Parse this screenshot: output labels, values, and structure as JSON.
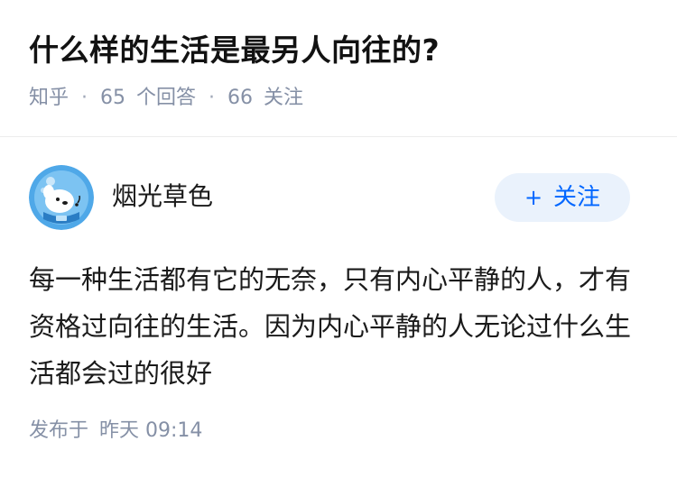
{
  "question": {
    "title": "什么样的生活是最另人向往的?",
    "source": "知乎",
    "answer_count": "65",
    "answer_label": "个回答",
    "follow_count": "66",
    "follow_label": "关注"
  },
  "answer": {
    "author": {
      "name": "烟光草色",
      "avatar_icon": "cartoon-dog-astronaut-avatar"
    },
    "follow_button": {
      "icon": "plus-icon",
      "label": "关注"
    },
    "content": "每一种生活都有它的无奈，只有内心平静的人，才有资格过向往的生活。因为内心平静的人无论过什么生活都会过的很好",
    "published_label": "发布于",
    "published_time": "昨天 09:14"
  },
  "colors": {
    "meta_gray": "#8590a6",
    "brand_blue": "#0066ff",
    "button_bg": "#eaf2fc",
    "avatar_bg": "#4fa8e8"
  }
}
